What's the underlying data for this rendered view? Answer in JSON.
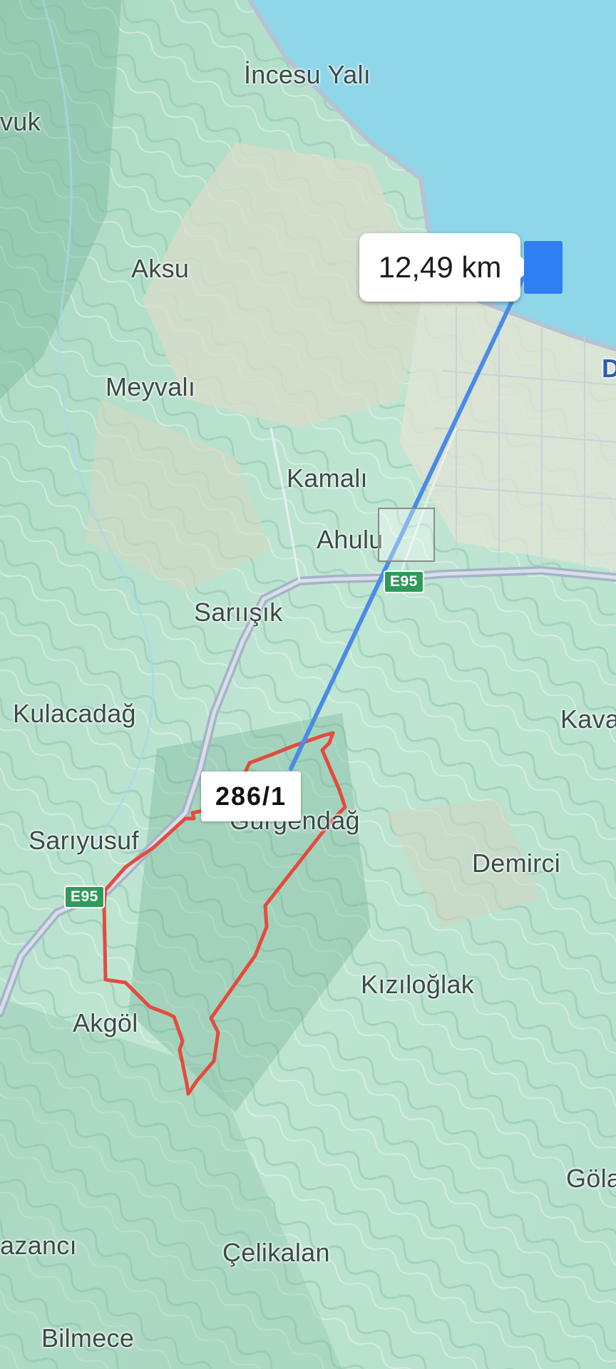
{
  "colors": {
    "sea": "#8fd6e8",
    "route_line": "#4a8be8",
    "parcel_outline": "#e44b3e",
    "road": "#aab6c8",
    "shield": "#2f9a5a",
    "marker": "#2f7ef3"
  },
  "distance_label": "12,49 km",
  "parcel_label": "286/1",
  "road_shields": [
    {
      "label": "E95"
    },
    {
      "label": "E95"
    }
  ],
  "places": [
    {
      "name": "İncesu Yalı"
    },
    {
      "name": "vuk"
    },
    {
      "name": "Aksu"
    },
    {
      "name": "Meyvalı"
    },
    {
      "name": "Kamalı"
    },
    {
      "name": "Ahulu"
    },
    {
      "name": "Sarıışık"
    },
    {
      "name": "Kulacadağ"
    },
    {
      "name": "Kava"
    },
    {
      "name": "Gürgendağ"
    },
    {
      "name": "Sarıyusuf"
    },
    {
      "name": "Demirci"
    },
    {
      "name": "Kızıloğlak"
    },
    {
      "name": "Akgöl"
    },
    {
      "name": "Göla"
    },
    {
      "name": "azancı"
    },
    {
      "name": "Çelikalan"
    },
    {
      "name": "Bilmece"
    },
    {
      "name": "D"
    }
  ],
  "icons": {
    "end_marker": "destination-marker-icon"
  }
}
